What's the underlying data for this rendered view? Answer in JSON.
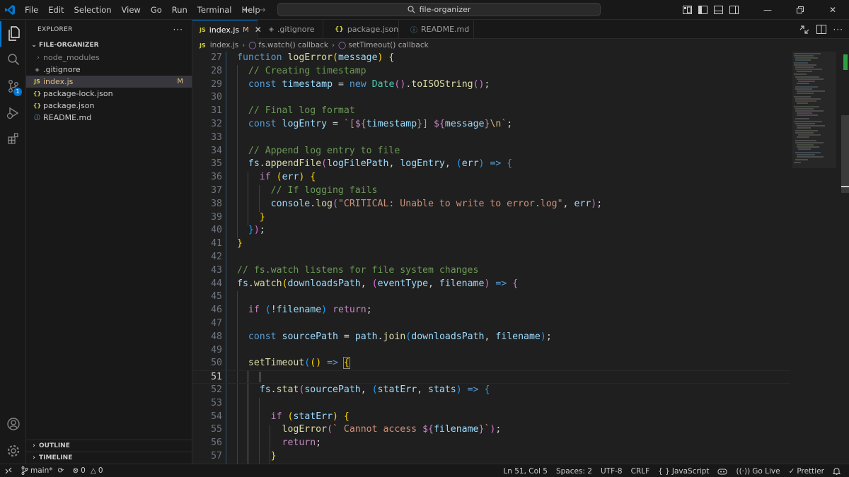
{
  "titlebar": {
    "menu": [
      "File",
      "Edit",
      "Selection",
      "View",
      "Go",
      "Run",
      "Terminal",
      "Help"
    ],
    "search_text": "file-organizer"
  },
  "activity": {
    "scm_badge": "1"
  },
  "explorer": {
    "title": "EXPLORER",
    "folder": "FILE-ORGANIZER",
    "files": [
      {
        "name": "node_modules",
        "kind": "folder"
      },
      {
        "name": ".gitignore",
        "kind": "gitignore"
      },
      {
        "name": "index.js",
        "kind": "js",
        "badge": "M"
      },
      {
        "name": "package-lock.json",
        "kind": "json"
      },
      {
        "name": "package.json",
        "kind": "json"
      },
      {
        "name": "README.md",
        "kind": "md"
      }
    ],
    "outline": "OUTLINE",
    "timeline": "TIMELINE"
  },
  "tabs": [
    {
      "label": "index.js",
      "badge": "M",
      "icon": "JS"
    },
    {
      "label": ".gitignore",
      "icon": "◈"
    },
    {
      "label": "package.json",
      "icon": "{}"
    },
    {
      "label": "README.md",
      "icon": "ⓘ"
    }
  ],
  "breadcrumb": {
    "file": "index.js",
    "fn1": "fs.watch() callback",
    "fn2": "setTimeout() callback",
    "js_icon": "JS"
  },
  "editor": {
    "current_line": 51,
    "lines": [
      27,
      28,
      29,
      30,
      31,
      32,
      33,
      34,
      35,
      36,
      37,
      38,
      39,
      40,
      41,
      42,
      43,
      44,
      45,
      46,
      47,
      48,
      49,
      50,
      51,
      52,
      53,
      54,
      55,
      56,
      57
    ],
    "code": {
      "l27": [
        "function",
        " ",
        "logError",
        "(",
        "message",
        ") ",
        "{"
      ],
      "l28": "// Creating timestamp",
      "l29": [
        "const",
        "timestamp",
        "=",
        "new",
        "Date",
        "().",
        "toISOString",
        "();"
      ],
      "l31": "// Final log format",
      "l32": [
        "const",
        "logEntry",
        "=",
        "`[",
        "${",
        "timestamp",
        "}",
        "] ",
        "${",
        "message",
        "}",
        "\\n",
        "`;"
      ],
      "l34": "// Append log entry to file",
      "l35": [
        "fs",
        ".",
        "appendFile",
        "(",
        "logFilePath",
        ", ",
        "logEntry",
        ", (",
        "err",
        ") => {"
      ],
      "l36": [
        "if",
        " (",
        "err",
        ") {"
      ],
      "l37": "// If logging fails",
      "l38": [
        "console",
        ".",
        "log",
        "(",
        "\"CRITICAL: Unable to write to error.log\"",
        ", ",
        "err",
        ");"
      ],
      "l39": "}",
      "l40": "});",
      "l41": "}",
      "l43": "// fs.watch listens for file system changes",
      "l44": [
        "fs",
        ".",
        "watch",
        "(",
        "downloadsPath",
        ", (",
        "eventType",
        ", ",
        "filename",
        ") => {"
      ],
      "l46": [
        "if",
        " (!",
        "filename",
        ") ",
        "return",
        ";"
      ],
      "l48": [
        "const",
        "sourcePath",
        "=",
        "path",
        ".",
        "join",
        "(",
        "downloadsPath",
        ", ",
        "filename",
        ");"
      ],
      "l50": [
        "setTimeout",
        "(",
        "()",
        " => ",
        "{"
      ],
      "l52": [
        "fs",
        ".",
        "stat",
        "(",
        "sourcePath",
        ", (",
        "statErr",
        ", ",
        "stats",
        ") => {"
      ],
      "l54": [
        "if",
        " (",
        "statErr",
        ") {"
      ],
      "l55": [
        "logError",
        "(",
        "` Cannot access ",
        "${",
        "filename",
        "}",
        "`",
        ");"
      ],
      "l56": [
        "return",
        ";"
      ],
      "l57": "}"
    }
  },
  "statusbar": {
    "branch": "main*",
    "errors": "0",
    "warnings": "0",
    "position": "Ln 51, Col 5",
    "spaces": "Spaces: 2",
    "encoding": "UTF-8",
    "eol": "CRLF",
    "language": "JavaScript",
    "golive": "Go Live",
    "prettier": "Prettier"
  },
  "colors": {
    "accent": "#0078d4",
    "modified": "#e2c08d",
    "js_icon": "#cbcb41",
    "json_icon": "#cbcb41",
    "md_icon": "#519aba"
  }
}
